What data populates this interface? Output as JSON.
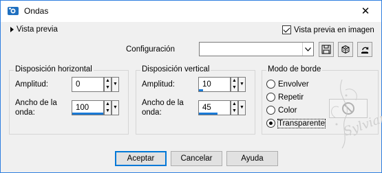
{
  "window": {
    "title": "Ondas",
    "close_symbol": "✕"
  },
  "preview_toggle": {
    "label": "Vista previa"
  },
  "preview_checkbox": {
    "label": "Vista previa en imagen",
    "checked": true
  },
  "configuration": {
    "label": "Configuración",
    "value": ""
  },
  "horizontal": {
    "title": "Disposición horizontal",
    "amplitude": {
      "label": "Amplitud:",
      "value": "0",
      "fill_percent": 0
    },
    "wavelength": {
      "label_line1": "Ancho de la",
      "label_line2": "onda:",
      "value": "100",
      "fill_percent": 100
    }
  },
  "vertical": {
    "title": "Disposición vertical",
    "amplitude": {
      "label": "Amplitud:",
      "value": "10",
      "fill_percent": 14
    },
    "wavelength": {
      "label_line1": "Ancho de la",
      "label_line2": "onda:",
      "value": "45",
      "fill_percent": 60
    }
  },
  "edge_mode": {
    "title": "Modo de borde",
    "options": [
      {
        "label": "Envolver",
        "checked": false
      },
      {
        "label": "Repetir",
        "checked": false
      },
      {
        "label": "Color",
        "checked": false
      },
      {
        "label": "Transparente",
        "checked": true
      }
    ]
  },
  "buttons": {
    "ok": "Aceptar",
    "cancel": "Cancelar",
    "help": "Ayuda"
  },
  "watermark": {
    "text": "Sylvian"
  },
  "colors": {
    "accent": "#1a7ad6",
    "window_border": "#2f7fe0",
    "dialog_bg": "#f0f0f0"
  }
}
